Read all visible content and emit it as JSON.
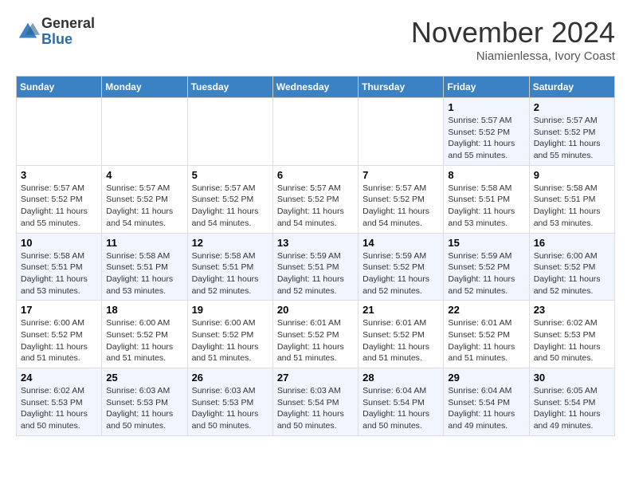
{
  "header": {
    "logo_line1": "General",
    "logo_line2": "Blue",
    "month_title": "November 2024",
    "location": "Niamienlessa, Ivory Coast"
  },
  "weekdays": [
    "Sunday",
    "Monday",
    "Tuesday",
    "Wednesday",
    "Thursday",
    "Friday",
    "Saturday"
  ],
  "weeks": [
    [
      {
        "day": "",
        "info": ""
      },
      {
        "day": "",
        "info": ""
      },
      {
        "day": "",
        "info": ""
      },
      {
        "day": "",
        "info": ""
      },
      {
        "day": "",
        "info": ""
      },
      {
        "day": "1",
        "info": "Sunrise: 5:57 AM\nSunset: 5:52 PM\nDaylight: 11 hours\nand 55 minutes."
      },
      {
        "day": "2",
        "info": "Sunrise: 5:57 AM\nSunset: 5:52 PM\nDaylight: 11 hours\nand 55 minutes."
      }
    ],
    [
      {
        "day": "3",
        "info": "Sunrise: 5:57 AM\nSunset: 5:52 PM\nDaylight: 11 hours\nand 55 minutes."
      },
      {
        "day": "4",
        "info": "Sunrise: 5:57 AM\nSunset: 5:52 PM\nDaylight: 11 hours\nand 54 minutes."
      },
      {
        "day": "5",
        "info": "Sunrise: 5:57 AM\nSunset: 5:52 PM\nDaylight: 11 hours\nand 54 minutes."
      },
      {
        "day": "6",
        "info": "Sunrise: 5:57 AM\nSunset: 5:52 PM\nDaylight: 11 hours\nand 54 minutes."
      },
      {
        "day": "7",
        "info": "Sunrise: 5:57 AM\nSunset: 5:52 PM\nDaylight: 11 hours\nand 54 minutes."
      },
      {
        "day": "8",
        "info": "Sunrise: 5:58 AM\nSunset: 5:51 PM\nDaylight: 11 hours\nand 53 minutes."
      },
      {
        "day": "9",
        "info": "Sunrise: 5:58 AM\nSunset: 5:51 PM\nDaylight: 11 hours\nand 53 minutes."
      }
    ],
    [
      {
        "day": "10",
        "info": "Sunrise: 5:58 AM\nSunset: 5:51 PM\nDaylight: 11 hours\nand 53 minutes."
      },
      {
        "day": "11",
        "info": "Sunrise: 5:58 AM\nSunset: 5:51 PM\nDaylight: 11 hours\nand 53 minutes."
      },
      {
        "day": "12",
        "info": "Sunrise: 5:58 AM\nSunset: 5:51 PM\nDaylight: 11 hours\nand 52 minutes."
      },
      {
        "day": "13",
        "info": "Sunrise: 5:59 AM\nSunset: 5:51 PM\nDaylight: 11 hours\nand 52 minutes."
      },
      {
        "day": "14",
        "info": "Sunrise: 5:59 AM\nSunset: 5:52 PM\nDaylight: 11 hours\nand 52 minutes."
      },
      {
        "day": "15",
        "info": "Sunrise: 5:59 AM\nSunset: 5:52 PM\nDaylight: 11 hours\nand 52 minutes."
      },
      {
        "day": "16",
        "info": "Sunrise: 6:00 AM\nSunset: 5:52 PM\nDaylight: 11 hours\nand 52 minutes."
      }
    ],
    [
      {
        "day": "17",
        "info": "Sunrise: 6:00 AM\nSunset: 5:52 PM\nDaylight: 11 hours\nand 51 minutes."
      },
      {
        "day": "18",
        "info": "Sunrise: 6:00 AM\nSunset: 5:52 PM\nDaylight: 11 hours\nand 51 minutes."
      },
      {
        "day": "19",
        "info": "Sunrise: 6:00 AM\nSunset: 5:52 PM\nDaylight: 11 hours\nand 51 minutes."
      },
      {
        "day": "20",
        "info": "Sunrise: 6:01 AM\nSunset: 5:52 PM\nDaylight: 11 hours\nand 51 minutes."
      },
      {
        "day": "21",
        "info": "Sunrise: 6:01 AM\nSunset: 5:52 PM\nDaylight: 11 hours\nand 51 minutes."
      },
      {
        "day": "22",
        "info": "Sunrise: 6:01 AM\nSunset: 5:52 PM\nDaylight: 11 hours\nand 51 minutes."
      },
      {
        "day": "23",
        "info": "Sunrise: 6:02 AM\nSunset: 5:53 PM\nDaylight: 11 hours\nand 50 minutes."
      }
    ],
    [
      {
        "day": "24",
        "info": "Sunrise: 6:02 AM\nSunset: 5:53 PM\nDaylight: 11 hours\nand 50 minutes."
      },
      {
        "day": "25",
        "info": "Sunrise: 6:03 AM\nSunset: 5:53 PM\nDaylight: 11 hours\nand 50 minutes."
      },
      {
        "day": "26",
        "info": "Sunrise: 6:03 AM\nSunset: 5:53 PM\nDaylight: 11 hours\nand 50 minutes."
      },
      {
        "day": "27",
        "info": "Sunrise: 6:03 AM\nSunset: 5:54 PM\nDaylight: 11 hours\nand 50 minutes."
      },
      {
        "day": "28",
        "info": "Sunrise: 6:04 AM\nSunset: 5:54 PM\nDaylight: 11 hours\nand 50 minutes."
      },
      {
        "day": "29",
        "info": "Sunrise: 6:04 AM\nSunset: 5:54 PM\nDaylight: 11 hours\nand 49 minutes."
      },
      {
        "day": "30",
        "info": "Sunrise: 6:05 AM\nSunset: 5:54 PM\nDaylight: 11 hours\nand 49 minutes."
      }
    ]
  ]
}
